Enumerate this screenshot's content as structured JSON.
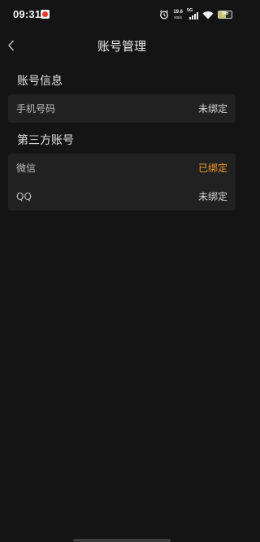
{
  "status_bar": {
    "time": "09:31",
    "net_speed_value": "19.6",
    "net_speed_unit": "KB/s",
    "signal_label": "5G",
    "battery_level": "56",
    "battery_fraction": 0.56
  },
  "nav": {
    "title": "账号管理"
  },
  "account_info": {
    "section_title": "账号信息",
    "rows": [
      {
        "label": "手机号码",
        "value": "未绑定"
      }
    ]
  },
  "third_party": {
    "section_title": "第三方账号",
    "rows": [
      {
        "label": "微信",
        "value": "已绑定"
      },
      {
        "label": "QQ",
        "value": "未绑定"
      }
    ]
  },
  "colors": {
    "background": "#141414",
    "card": "#212121",
    "bound_accent": "#f39c23"
  }
}
